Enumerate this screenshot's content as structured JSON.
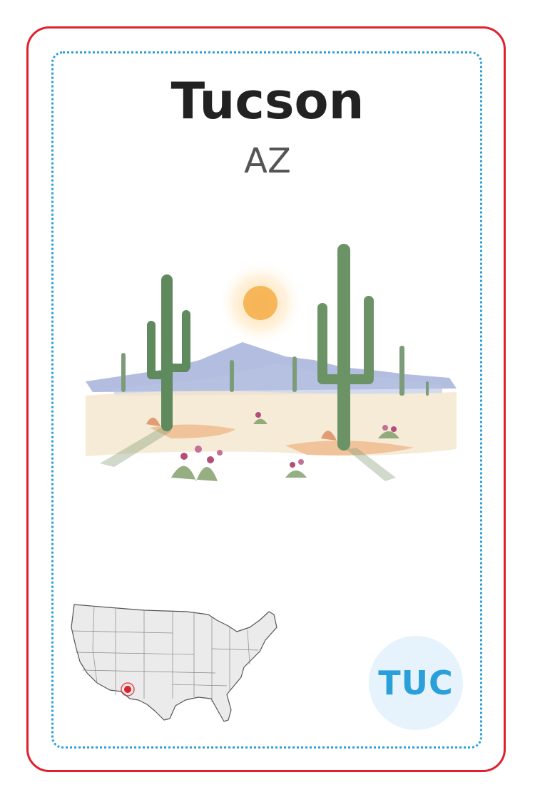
{
  "card": {
    "city": "Tucson",
    "state": "AZ",
    "airport_code": "TUC",
    "icons": [
      "saguaro-desert-illustration",
      "us-map-icon",
      "location-marker-icon"
    ],
    "colors": {
      "border": "#e0202e",
      "inner_border": "#2b9fd9",
      "badge_bg": "#e6f3fc",
      "badge_text": "#2a9fd9",
      "marker": "#e0202e"
    }
  }
}
